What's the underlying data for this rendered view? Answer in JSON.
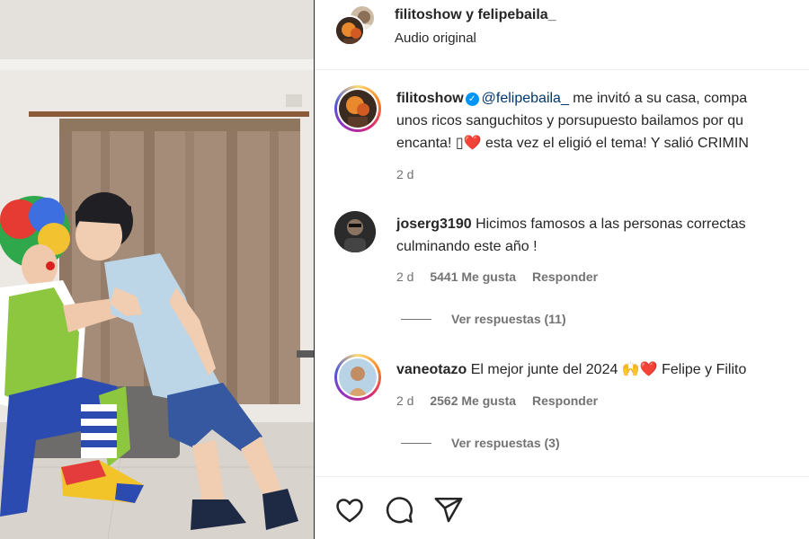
{
  "header": {
    "users": "filitoshow y felipebaila_",
    "audio": "Audio original"
  },
  "caption": {
    "username": "filitoshow",
    "mention": "@felipebaila_",
    "line1_rest": " me invitó a su casa, compa",
    "line2": "unos ricos sanguchitos y porsupuesto bailamos por qu",
    "line3_start": "encanta! ",
    "line3_missing_glyph": "▯",
    "line3_heart": "❤️",
    "line3_rest": " esta vez el eligió el tema! Y salió CRIMIN",
    "time": "2 d"
  },
  "comments": [
    {
      "username": "joserg3190",
      "text_line1": "Hicimos famosos a las personas correctas",
      "text_line2": "culminando este año !",
      "time": "2 d",
      "likes": "5441 Me gusta",
      "reply": "Responder",
      "view_replies": "Ver respuestas (11)"
    },
    {
      "username": "vaneotazo",
      "text_start": "El mejor junte del 2024 ",
      "emoji1": "🙌",
      "emoji2": "❤️",
      "text_end": " Felipe y Filito",
      "time": "2 d",
      "likes": "2562 Me gusta",
      "reply": "Responder",
      "view_replies": "Ver respuestas (3)"
    }
  ],
  "actions": {
    "like_icon": "heart-icon",
    "comment_icon": "comment-icon",
    "share_icon": "share-icon"
  },
  "colors": {
    "verified": "#0095f6",
    "mention": "#00376b",
    "secondary_text": "#737373"
  }
}
